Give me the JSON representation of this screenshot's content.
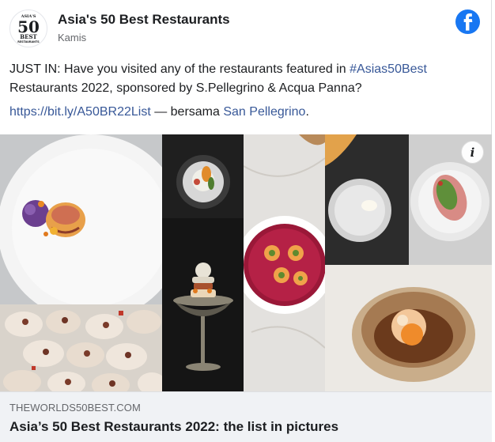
{
  "header": {
    "page_name": "Asia's 50 Best Restaurants",
    "post_time": "Kamis",
    "logo_text": {
      "top": "ASIA'S",
      "number": "50",
      "word": "BEST",
      "bottom": "RESTAURANTS"
    },
    "platform_icon": "facebook-icon",
    "brand_color": "#1877f2"
  },
  "post": {
    "text_part1": "JUST IN: Have you visited any of the restaurants featured in ",
    "hashtag": "#Asias50Best",
    "text_part2": " Restaurants 2022, sponsored by S.Pellegrino & Acqua Panna?",
    "link": "https://bit.ly/A50BR22List",
    "with_text": " — bersama ",
    "tagged": "San Pellegrino",
    "end_punct": ".",
    "link_color": "#385898"
  },
  "media": {
    "type": "photo-collage",
    "info_icon": "info-icon",
    "info_glyph": "i"
  },
  "preview": {
    "domain": "THEWORLDS50BEST.COM",
    "title": "Asia’s 50 Best Restaurants 2022: the list in pictures"
  }
}
